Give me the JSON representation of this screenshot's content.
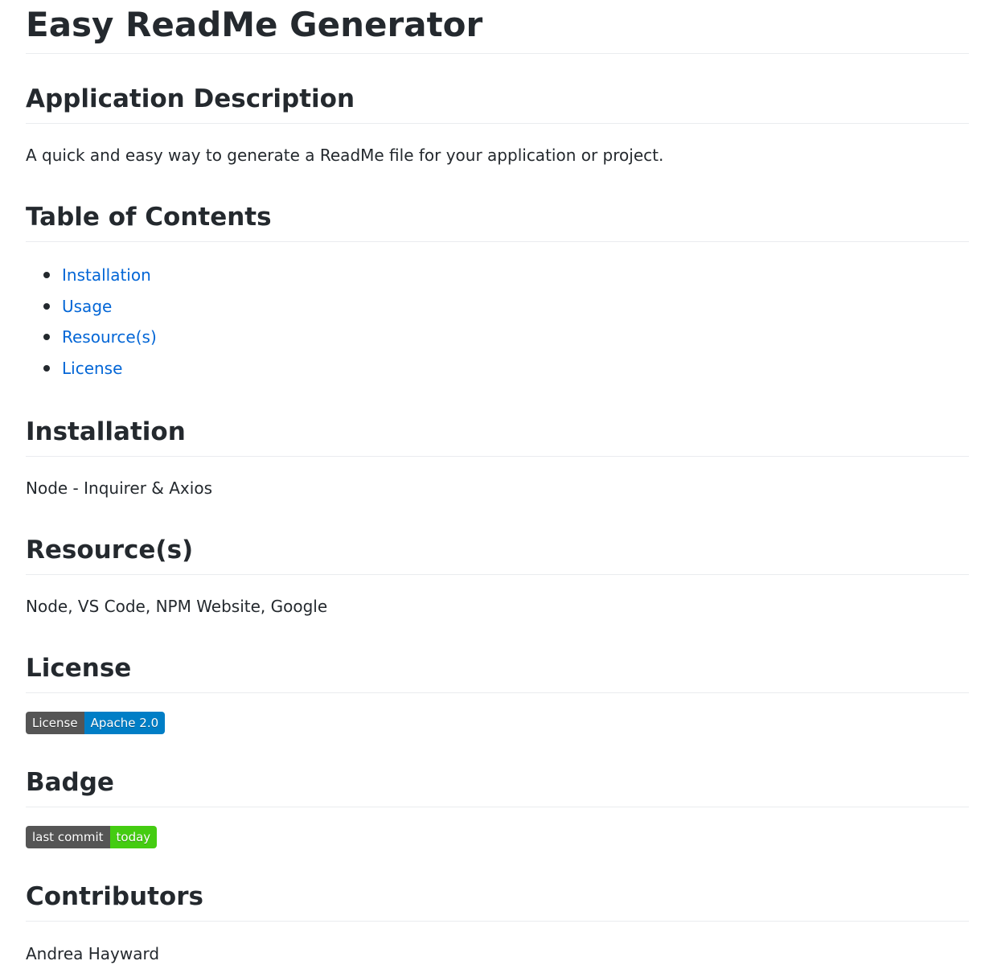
{
  "title": "Easy ReadMe Generator",
  "sections": {
    "description": {
      "heading": "Application Description",
      "text": "A quick and easy way to generate a ReadMe file for your application or project."
    },
    "toc": {
      "heading": "Table of Contents",
      "items": [
        "Installation",
        "Usage",
        "Resource(s)",
        "License"
      ]
    },
    "installation": {
      "heading": "Installation",
      "text": "Node - Inquirer & Axios"
    },
    "resources": {
      "heading": "Resource(s)",
      "text": "Node, VS Code, NPM Website, Google"
    },
    "license": {
      "heading": "License",
      "badge": {
        "label": "License",
        "value": "Apache 2.0",
        "label_color": "#555555",
        "value_color": "#007ec6"
      }
    },
    "badge": {
      "heading": "Badge",
      "badge": {
        "label": "last commit",
        "value": "today",
        "label_color": "#555555",
        "value_color": "#4c1"
      }
    },
    "contributors": {
      "heading": "Contributors",
      "text": "Andrea Hayward"
    }
  },
  "colors": {
    "link": "#0366d6",
    "text": "#24292e",
    "divider": "#eaecef"
  }
}
